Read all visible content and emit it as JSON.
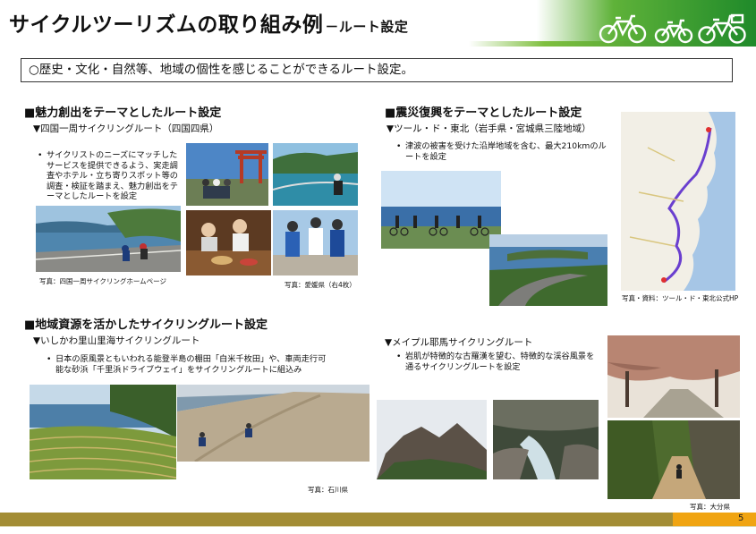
{
  "header": {
    "title": "サイクルツーリズムの取り組み例",
    "subtitle": "－ルート設定"
  },
  "intro": "○歴史・文化・自然等、地域の個性を感じることができるルート設定。",
  "sections": {
    "s1": {
      "heading": "■魅力創出をテーマとしたルート設定",
      "route": "▼四国一周サイクリングルート（四国四県）",
      "bullet": "サイクリストのニーズにマッチしたサービスを提供できるよう、実走調査やホテル・立ち寄りスポット等の調査・検証を踏まえ、魅力創出をテーマとしたルートを設定",
      "caption1": "写真：四国一周サイクリングホームページ",
      "caption2": "写真：愛媛県（右4枚）"
    },
    "s2": {
      "heading": "■震災復興をテーマとしたルート設定",
      "route": "▼ツール・ド・東北（岩手県・宮城県三陸地域）",
      "bullet": "津波の被害を受けた沿岸地域を含む、最大210kmのルートを設定",
      "caption": "写真・資料：ツール・ド・東北公式HP"
    },
    "s3": {
      "heading": "■地域資源を活かしたサイクリングルート設定",
      "route": "▼いしかわ里山里海サイクリングルート",
      "bullet": "日本の原風景ともいわれる能登半島の棚田「白米千枚田」や、車両走行可能な砂浜「千里浜ドライブウェイ」をサイクリングルートに組込み",
      "caption": "写真：石川県"
    },
    "s4": {
      "route": "▼メイプル耶馬サイクリングルート",
      "bullet": "岩肌が特徴的な古羅漢を望む、特徴的な渓谷風景を通るサイクリングルートを設定",
      "caption": "写真：大分県"
    }
  },
  "footer": {
    "page": "5"
  },
  "colors": {
    "header_green": "#1f8a2a",
    "footer_gold": "#a38d35",
    "footer_orange": "#f0a412"
  }
}
